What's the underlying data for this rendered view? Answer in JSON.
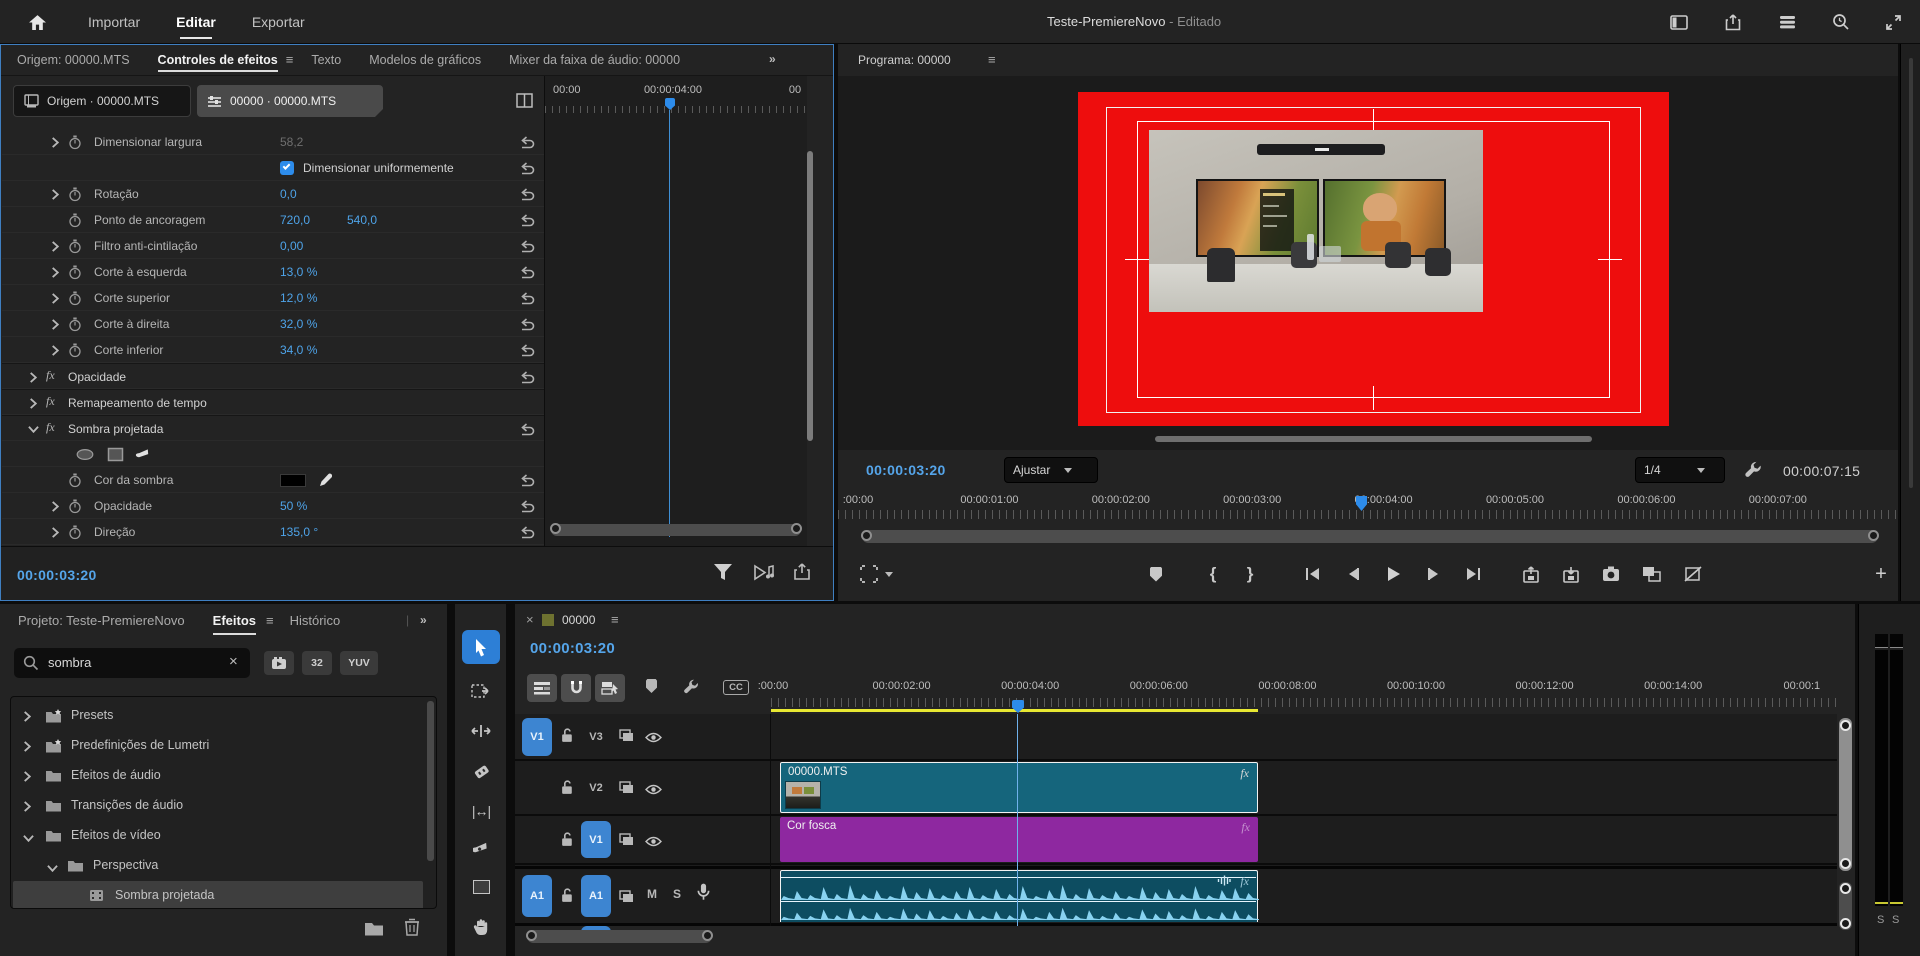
{
  "glyphs": {
    "hamburger": "≡",
    "overflow": "»",
    "close": "×",
    "plus": "+",
    "slip": "|↔|"
  },
  "topbar": {
    "menu": [
      {
        "label": "Importar",
        "active": false
      },
      {
        "label": "Editar",
        "active": true
      },
      {
        "label": "Exportar",
        "active": false
      }
    ],
    "title": "Teste-PremiereNovo",
    "title_state": "- Editado"
  },
  "effect_panel": {
    "tabs": [
      {
        "label": "Origem: 00000.MTS",
        "active": false
      },
      {
        "label": "Controles de efeitos",
        "active": true
      },
      {
        "label": "Texto",
        "active": false
      },
      {
        "label": "Modelos de gráficos",
        "active": false
      },
      {
        "label": "Mixer da faixa de áudio: 00000",
        "active": false
      }
    ],
    "source_button": "Origem · 00000.MTS",
    "sequence_button": "00000 · 00000.MTS",
    "ruler_labels": [
      "00:00",
      "00:00:04:00",
      "00"
    ],
    "fx_glyph": "fx",
    "rows": [
      {
        "kind": "param",
        "chevron": true,
        "label": "Dimensionar largura",
        "v1": "58,2",
        "dimmed": true,
        "reset": true
      },
      {
        "kind": "checkbox",
        "label": "Dimensionar uniformemente",
        "checked": true,
        "reset": true
      },
      {
        "kind": "param",
        "chevron": true,
        "label": "Rotação",
        "v1": "0,0",
        "reset": true
      },
      {
        "kind": "param",
        "chevron": false,
        "label": "Ponto de ancoragem",
        "v1": "720,0",
        "v2": "540,0",
        "reset": true
      },
      {
        "kind": "param",
        "chevron": true,
        "label": "Filtro anti-cintilação",
        "v1": "0,00",
        "reset": true
      },
      {
        "kind": "param",
        "chevron": true,
        "label": "Corte à esquerda",
        "v1": "13,0 %",
        "reset": true
      },
      {
        "kind": "param",
        "chevron": true,
        "label": "Corte superior",
        "v1": "12,0 %",
        "reset": true
      },
      {
        "kind": "param",
        "chevron": true,
        "label": "Corte à direita",
        "v1": "32,0 %",
        "reset": true
      },
      {
        "kind": "param",
        "chevron": true,
        "label": "Corte inferior",
        "v1": "34,0 %",
        "reset": true
      },
      {
        "kind": "group",
        "label": "Opacidade",
        "expanded": false,
        "reset": true
      },
      {
        "kind": "group",
        "label": "Remapeamento de tempo",
        "expanded": false,
        "reset": false
      },
      {
        "kind": "group",
        "label": "Sombra projetada",
        "expanded": true,
        "reset": true
      },
      {
        "kind": "masktools",
        "reset": false
      },
      {
        "kind": "color",
        "label": "Cor da sombra",
        "swatch": "#000000",
        "reset": true
      },
      {
        "kind": "param",
        "chevron": true,
        "label": "Opacidade",
        "v1": "50 %",
        "reset": true
      },
      {
        "kind": "param",
        "chevron": true,
        "label": "Direção",
        "v1": "135,0 °",
        "reset": true
      }
    ],
    "timecode": "00:00:03:20"
  },
  "program": {
    "title": "Programa: 00000",
    "timecode": "00:00:03:20",
    "fit_label": "Ajustar",
    "zoom_label": "1/4",
    "duration": "00:00:07:15",
    "ruler": [
      ":00:00",
      "00:00:01:00",
      "00:00:02:00",
      "00:00:03:00",
      "00:00:04:00",
      "00:00:05:00",
      "00:00:06:00",
      "00:00:07:00"
    ],
    "transport": {
      "mark_in_glyph": "{",
      "mark_out_glyph": "}"
    }
  },
  "project_panel": {
    "tabs": [
      {
        "label": "Projeto: Teste-PremiereNovo",
        "active": false
      },
      {
        "label": "Efeitos",
        "active": true
      },
      {
        "label": "Histórico",
        "active": false
      }
    ],
    "search_value": "sombra",
    "badges": {
      "bit32": "32",
      "yuv": "YUV"
    },
    "tree": [
      {
        "label": "Presets",
        "level": 0,
        "expanded": false,
        "icon": "folder-star",
        "selected": false
      },
      {
        "label": "Predefinições de Lumetri",
        "level": 0,
        "expanded": false,
        "icon": "folder-star",
        "selected": false
      },
      {
        "label": "Efeitos de áudio",
        "level": 0,
        "expanded": false,
        "icon": "folder",
        "selected": false
      },
      {
        "label": "Transições de áudio",
        "level": 0,
        "expanded": false,
        "icon": "folder",
        "selected": false
      },
      {
        "label": "Efeitos de vídeo",
        "level": 0,
        "expanded": true,
        "icon": "folder",
        "selected": false
      },
      {
        "label": "Perspectiva",
        "level": 1,
        "expanded": true,
        "icon": "folder",
        "selected": false
      },
      {
        "label": "Sombra projetada",
        "level": 2,
        "expanded": null,
        "icon": "effect",
        "selected": true
      }
    ]
  },
  "timeline": {
    "tab_label": "00000",
    "timecode": "00:00:03:20",
    "ruler": [
      ":00:00",
      "00:00:02:00",
      "00:00:04:00",
      "00:00:06:00",
      "00:00:08:00",
      "00:00:10:00",
      "00:00:12:00",
      "00:00:14:00",
      "00:00:1"
    ],
    "tracks": [
      {
        "source": "V1",
        "target": "V3",
        "target_active": false,
        "type": "video"
      },
      {
        "source": "",
        "target": "V2",
        "target_active": false,
        "type": "video"
      },
      {
        "source": "",
        "target": "V1",
        "target_active": true,
        "type": "video"
      },
      {
        "source": "A1",
        "target": "A1",
        "target_active": true,
        "type": "audio"
      }
    ],
    "mute_label": "M",
    "solo_label": "S",
    "cc_label": "CC",
    "fx_label": "fx",
    "clips": [
      {
        "name": "00000.MTS"
      },
      {
        "name": "Cor fosca"
      }
    ]
  },
  "meters": {
    "solo_labels": [
      "S",
      "S"
    ]
  }
}
